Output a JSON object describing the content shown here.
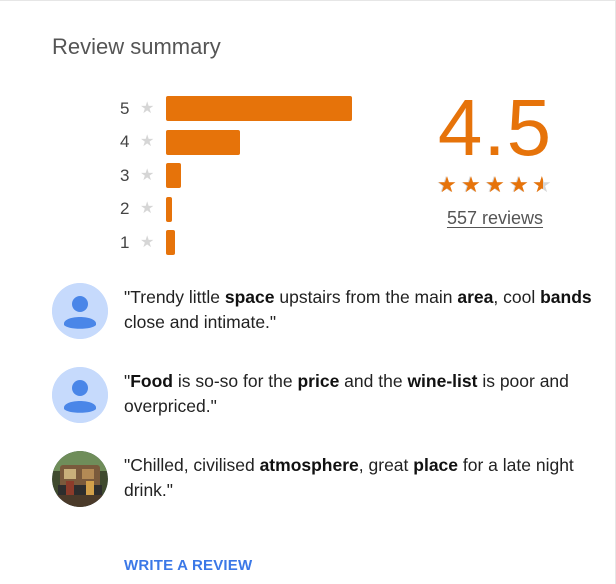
{
  "summary": {
    "title": "Review summary",
    "score": "4.5",
    "rating_value": 4.5,
    "rating_max": 5,
    "reviews_link": "557 reviews",
    "accent_color": "#e6730a",
    "star_empty_color": "#d6d6d6"
  },
  "histogram": {
    "rows": [
      {
        "label": "5",
        "fraction": 1.0
      },
      {
        "label": "4",
        "fraction": 0.4
      },
      {
        "label": "3",
        "fraction": 0.08
      },
      {
        "label": "2",
        "fraction": 0.03
      },
      {
        "label": "1",
        "fraction": 0.05
      }
    ]
  },
  "reviews": [
    {
      "avatar_icon": "person-avatar-icon",
      "segments": [
        {
          "text": "\"Trendy little ",
          "bold": false
        },
        {
          "text": "space",
          "bold": true
        },
        {
          "text": " upstairs from the main ",
          "bold": false
        },
        {
          "text": "area",
          "bold": true
        },
        {
          "text": ", cool ",
          "bold": false
        },
        {
          "text": "bands",
          "bold": true
        },
        {
          "text": " close and intimate.\"",
          "bold": false
        }
      ]
    },
    {
      "avatar_icon": "person-avatar-icon",
      "segments": [
        {
          "text": "\"",
          "bold": false
        },
        {
          "text": "Food",
          "bold": true
        },
        {
          "text": " is so-so for the ",
          "bold": false
        },
        {
          "text": "price",
          "bold": true
        },
        {
          "text": " and the ",
          "bold": false
        },
        {
          "text": "wine-list",
          "bold": true
        },
        {
          "text": " is poor and overpriced.\"",
          "bold": false
        }
      ]
    },
    {
      "avatar_icon": "photo-avatar-icon",
      "segments": [
        {
          "text": "\"Chilled, civilised ",
          "bold": false
        },
        {
          "text": "atmosphere",
          "bold": true
        },
        {
          "text": ", great ",
          "bold": false
        },
        {
          "text": "place",
          "bold": true
        },
        {
          "text": " for a late night drink.\"",
          "bold": false
        }
      ]
    }
  ],
  "actions": {
    "write_review": "WRITE A REVIEW",
    "link_color": "#3b78e7"
  }
}
